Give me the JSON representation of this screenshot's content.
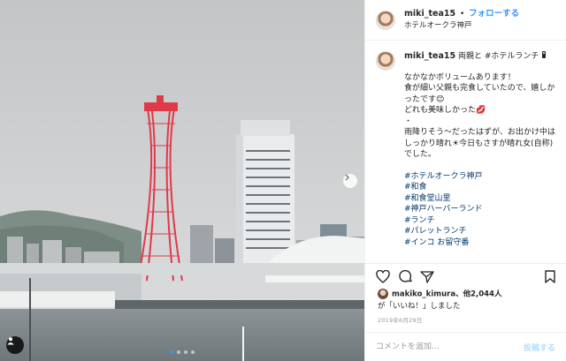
{
  "post": {
    "username": "miki_tea15",
    "separator": "•",
    "follow_label": "フォローする",
    "location": "ホテルオークラ神戸",
    "caption_head": "両親と #ホテルランチ",
    "caption_lines": [
      "なかなかボリュームあります！",
      "食が細い父親も完食していたので、嬉しかったです😊",
      "どれも美味しかった💋",
      "・",
      "雨降りそう〜だったはずが、お出かけ中はしっかり晴れ☀今日もさすが晴れ女(自称)でした。"
    ],
    "hashtags": [
      "#ホテルオークラ神戸",
      "#和食",
      "#和食堂山里",
      "#神戸ハーバーランド",
      "#ランチ",
      "#パレットランチ",
      "#インコ お留守番"
    ],
    "likes_user": "makiko_kimura",
    "likes_text": "、他2,044人",
    "likes_suffix": "が「いいね！」しました",
    "date": "2019年6月29日",
    "comment_placeholder": "コメントを追加...",
    "post_label": "投稿する"
  },
  "icons": {
    "like": "heart-icon",
    "comment": "comment-icon",
    "share": "share-icon",
    "save": "bookmark-icon",
    "next": "chevron-right-icon",
    "tag": "user-tag-icon"
  },
  "carousel": {
    "count": 4,
    "active": 1
  },
  "colors": {
    "link": "#3897f0",
    "hashtag": "#003569",
    "tower": "#e03a4a"
  }
}
